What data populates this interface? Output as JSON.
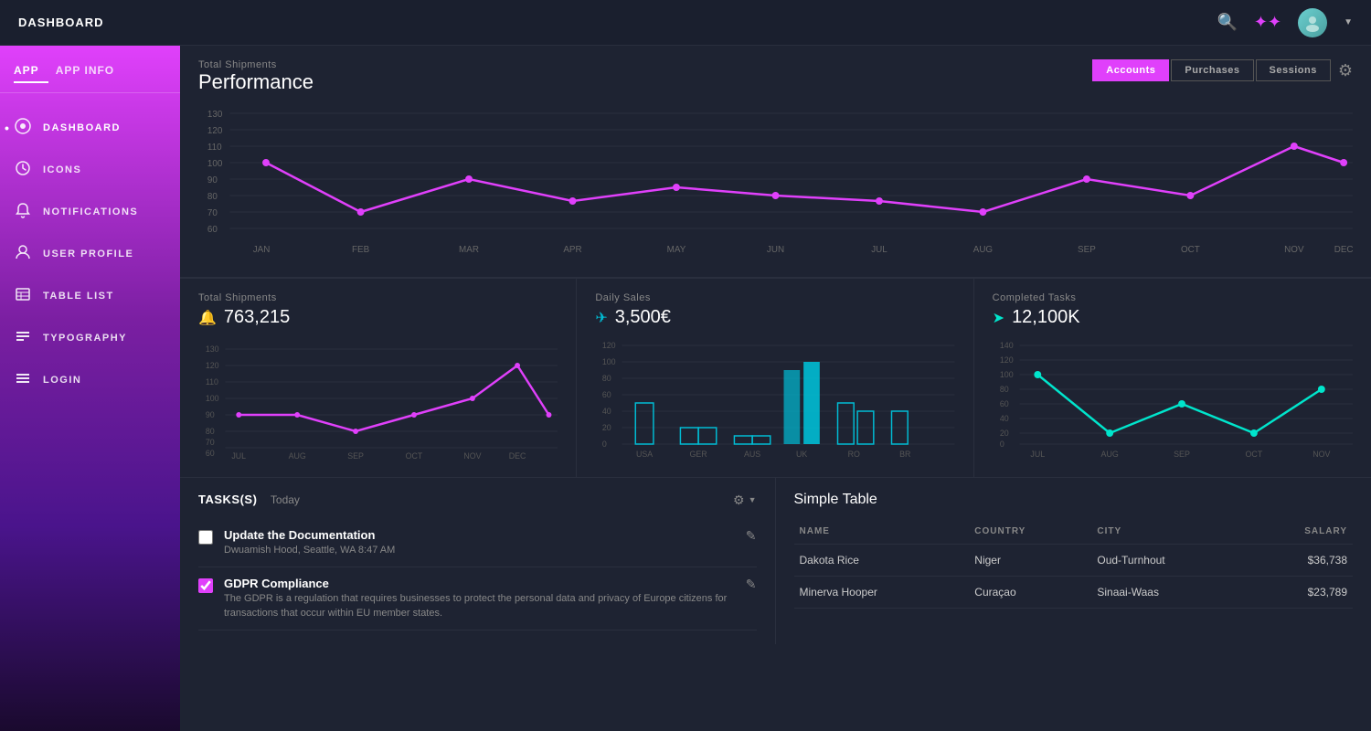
{
  "topnav": {
    "title": "DASHBOARD"
  },
  "sidebar": {
    "tab1": "APP",
    "tab2": "APP INFO",
    "items": [
      {
        "id": "dashboard",
        "label": "DASHBOARD",
        "icon": "◉",
        "active": true
      },
      {
        "id": "icons",
        "label": "ICONS",
        "icon": "⚙",
        "active": false
      },
      {
        "id": "notifications",
        "label": "NOTIFICATIONS",
        "icon": "🔔",
        "active": false
      },
      {
        "id": "user-profile",
        "label": "USER PROFILE",
        "icon": "👤",
        "active": false
      },
      {
        "id": "table-list",
        "label": "TABLE LIST",
        "icon": "✦",
        "active": false
      },
      {
        "id": "typography",
        "label": "TYPOGRAPHY",
        "icon": "≡",
        "active": false
      },
      {
        "id": "login",
        "label": "LOGIN",
        "icon": "≡",
        "active": false
      }
    ]
  },
  "performance": {
    "subtitle": "Total Shipments",
    "title": "Performance",
    "tabs": [
      "Accounts",
      "Purchases",
      "Sessions"
    ],
    "active_tab": "Accounts"
  },
  "stats": [
    {
      "subtitle": "Total Shipments",
      "icon": "🔔",
      "icon_class": "pink",
      "value": "763,215"
    },
    {
      "subtitle": "Daily Sales",
      "icon": "✈",
      "icon_class": "blue",
      "value": "3,500€"
    },
    {
      "subtitle": "Completed Tasks",
      "icon": "✈",
      "icon_class": "teal",
      "value": "12,100K"
    }
  ],
  "tasks": {
    "title": "TASKS(S)",
    "period": "Today",
    "items": [
      {
        "name": "Update the Documentation",
        "desc": "Dwuamish Hood, Seattle, WA 8:47 AM",
        "checked": false
      },
      {
        "name": "GDPR Compliance",
        "desc": "The GDPR is a regulation that requires businesses to protect the personal data and privacy of Europe citizens for transactions that occur within EU member states.",
        "checked": true
      }
    ]
  },
  "simple_table": {
    "title": "Simple Table",
    "headers": [
      "NAME",
      "COUNTRY",
      "CITY",
      "SALARY"
    ],
    "rows": [
      {
        "name": "Dakota Rice",
        "country": "Niger",
        "city": "Oud-Turnhout",
        "salary": "$36,738"
      },
      {
        "name": "Minerva Hooper",
        "country": "Curaçao",
        "city": "Sinaai-Waas",
        "salary": "$23,789"
      }
    ]
  }
}
